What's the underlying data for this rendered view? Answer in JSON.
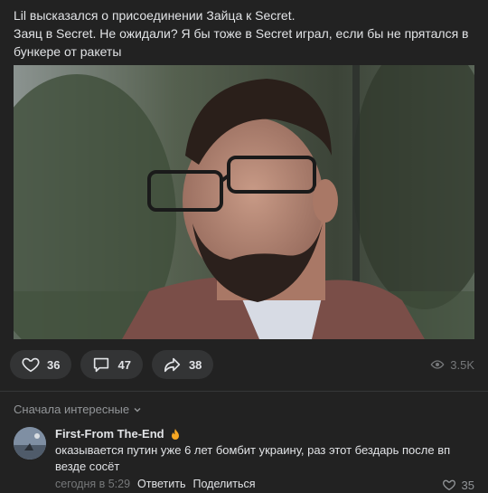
{
  "post": {
    "lines": [
      "Lil высказался о присоединении Зайца к Secret.",
      "Заяц в Secret. Не ожидали? Я бы тоже в Secret играл, если бы не прятался в",
      "бункере от ракеты"
    ]
  },
  "actions": {
    "likes": "36",
    "comments": "47",
    "shares": "38",
    "views": "3.5K"
  },
  "icons": {
    "like": "heart-icon",
    "comment": "comment-icon",
    "share": "share-icon",
    "views": "eye-icon",
    "sort": "chevron-down-icon",
    "author_badge": "fire-emoji"
  },
  "comments": {
    "sort_label": "Сначала интересные",
    "items": [
      {
        "author": "First-From The-End",
        "text_lines": [
          "оказывается путин уже 6 лет бомбит украину, раз этот бездарь после вп",
          "везде сосёт"
        ],
        "time": "сегодня в 5:29",
        "reply_label": "Ответить",
        "share_label": "Поделиться",
        "likes": "35"
      }
    ]
  }
}
